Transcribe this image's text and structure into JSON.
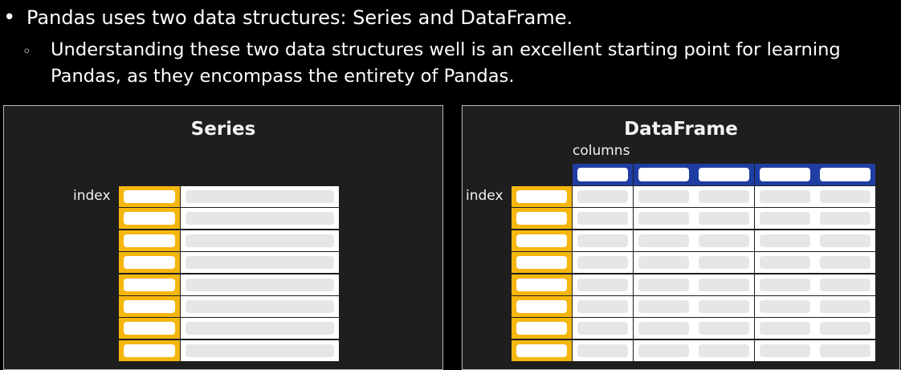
{
  "slide": {
    "bullet_main": "Pandas uses two data structures: Series and DataFrame.",
    "bullet_sub": "Understanding these two data structures well is an excellent starting point for learning Pandas, as they encompass the entirety of Pandas.",
    "bullet_main_marker": "•",
    "bullet_sub_marker": "◦"
  },
  "series_panel": {
    "title": "Series",
    "index_label": "index",
    "row_count": 8
  },
  "dataframe_panel": {
    "title": "DataFrame",
    "index_label": "index",
    "columns_label": "columns",
    "row_count": 8,
    "column_count": 5
  },
  "colors": {
    "background": "#000000",
    "panel": "#1e1e1e",
    "index_yellow": "#f5b60e",
    "column_blue": "#1f3da3",
    "value_gray": "#e6e6e6"
  }
}
